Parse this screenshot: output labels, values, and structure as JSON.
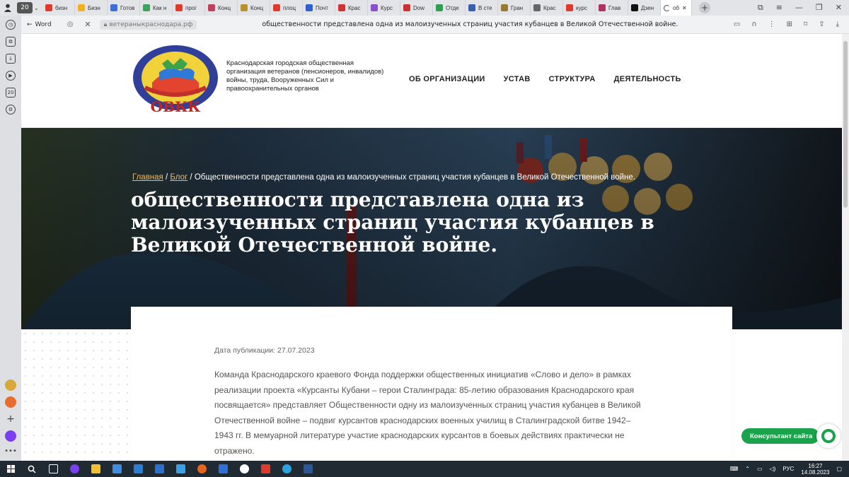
{
  "browser": {
    "tab_count": "20",
    "tabs": [
      {
        "label": "бизн",
        "color": "#e23a2a"
      },
      {
        "label": "Бизн",
        "color": "#f2b01e"
      },
      {
        "label": "Готов",
        "color": "#3c6fd8"
      },
      {
        "label": "Как н",
        "color": "#3da35a"
      },
      {
        "label": "прог",
        "color": "#e23a2a"
      },
      {
        "label": "Конц",
        "color": "#c04060"
      },
      {
        "label": "Конц",
        "color": "#b8902c"
      },
      {
        "label": "плоц",
        "color": "#e23a2a"
      },
      {
        "label": "Почт",
        "color": "#2f5fd0"
      },
      {
        "label": "Крас",
        "color": "#d33030"
      },
      {
        "label": "Курс",
        "color": "#8a4fd0"
      },
      {
        "label": "Dow",
        "color": "#d03030"
      },
      {
        "label": "Отде",
        "color": "#2e9e50"
      },
      {
        "label": "В сте",
        "color": "#3a5fb0"
      },
      {
        "label": "Гран",
        "color": "#9a7a30"
      },
      {
        "label": "Крас",
        "color": "#666666"
      },
      {
        "label": "курс",
        "color": "#e23a2a"
      },
      {
        "label": "Глав",
        "color": "#b03060"
      },
      {
        "label": "Дзен",
        "color": "#111111"
      }
    ],
    "active_tab_label": "об",
    "back_label": "Word",
    "url": "ветераныкраснодара.рф",
    "page_title": "общественности представлена одна из малоизученных страниц участия кубанцев в Великой Отечественной войне."
  },
  "site": {
    "logo_text": "ОВКК",
    "org_name": "Краснодарская городская общественная организация ветеранов (пенсионеров, инвалидов) войны, труда, Вооруженных Сил и правоохранительных органов",
    "nav": [
      "ОБ ОРГАНИЗАЦИИ",
      "УСТАВ",
      "СТРУКТУРА",
      "ДЕЯТЕЛЬНОСТЬ"
    ]
  },
  "hero": {
    "breadcrumb_home": "Главная",
    "breadcrumb_blog": "Блог",
    "breadcrumb_current": "Общественности представлена одна из малоизученных страниц участия кубанцев в Великой Отечественной войне.",
    "title": "общественности представлена одна из малоизученных страниц участия кубанцев в Великой Отечественной войне."
  },
  "article": {
    "pub_date": "Дата публикации: 27.07.2023",
    "body": "Команда Краснодарского краевого Фонда поддержки общественных инициатив «Слово и дело» в рамках реализации проекта «Курсанты Кубани – герои Сталинграда: 85-летию образования Краснодарского края посвящается» представляет Общественности одну из малоизученных страниц участия кубанцев в Великой Отечественной войне – подвиг курсантов краснодарских военных училищ в Сталинградской битве 1942–1943 гг. В мемуарной литературе участие краснодарских курсантов в боевых действиях практически не отражено."
  },
  "widget": {
    "consultant_label": "Консультант сайта"
  },
  "taskbar": {
    "lang": "РУС",
    "time": "16:27",
    "date": "14.08.2023"
  }
}
